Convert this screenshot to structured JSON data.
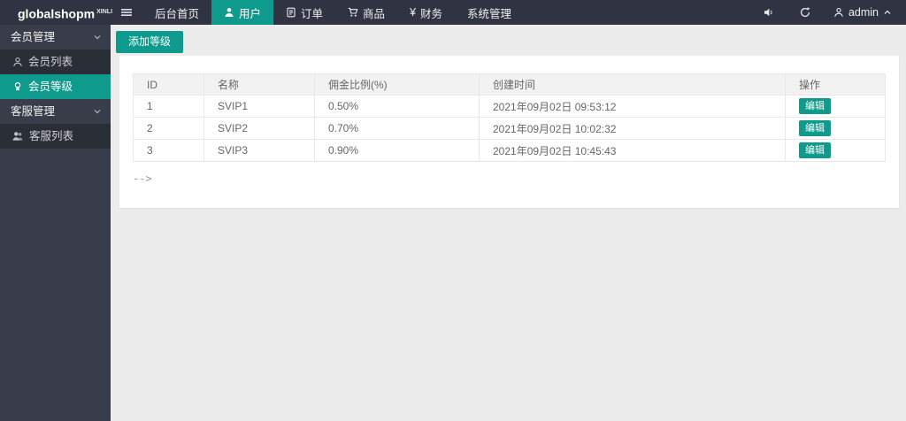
{
  "colors": {
    "accent": "#0e9a8c",
    "navbar_bg": "#2f3342",
    "sidebar_bg": "#393d49",
    "content_bg": "#ececec"
  },
  "navbar": {
    "brand": "globalshopm",
    "brand_sup": "XINLI",
    "items": [
      {
        "label": "后台首页",
        "icon": null
      },
      {
        "label": "用户",
        "icon": "user-icon",
        "active": true
      },
      {
        "label": "订单",
        "icon": "order-icon"
      },
      {
        "label": "商品",
        "icon": "cart-icon"
      },
      {
        "label": "财务",
        "icon": "yen-icon"
      },
      {
        "label": "系统管理",
        "icon": null
      }
    ],
    "finance_symbol": "¥",
    "admin_label": "admin"
  },
  "sidebar": {
    "groups": [
      {
        "label": "会员管理",
        "items": [
          {
            "label": "会员列表",
            "icon": "member-icon"
          },
          {
            "label": "会员等级",
            "icon": "level-icon",
            "active": true
          }
        ]
      },
      {
        "label": "客服管理",
        "items": [
          {
            "label": "客服列表",
            "icon": "service-team-icon"
          }
        ]
      }
    ]
  },
  "main": {
    "add_button": "添加等级",
    "table": {
      "headers": [
        "ID",
        "名称",
        "佣金比例(%)",
        "创建时间",
        "操作"
      ],
      "rows": [
        {
          "id": "1",
          "name": "SVIP1",
          "rate": "0.50%",
          "created": "2021年09月02日 09:53:12",
          "action": "编辑"
        },
        {
          "id": "2",
          "name": "SVIP2",
          "rate": "0.70%",
          "created": "2021年09月02日 10:02:32",
          "action": "编辑"
        },
        {
          "id": "3",
          "name": "SVIP3",
          "rate": "0.90%",
          "created": "2021年09月02日 10:45:43",
          "action": "编辑"
        }
      ]
    },
    "footer_note": "--&gt;"
  }
}
